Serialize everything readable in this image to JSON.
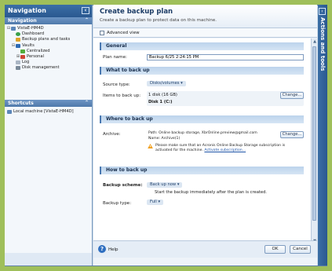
{
  "navigation": {
    "title": "Navigation",
    "section_label": "Navigation",
    "tree": [
      {
        "label": "VistaE-HM4D",
        "icon": "computer-icon",
        "indent": 0,
        "expander": "⊟"
      },
      {
        "label": "Dashboard",
        "icon": "dashboard-icon",
        "indent": 1,
        "expander": ""
      },
      {
        "label": "Backup plans and tasks",
        "icon": "backup-plans-icon",
        "indent": 1,
        "expander": ""
      },
      {
        "label": "Vaults",
        "icon": "vault-icon",
        "indent": 1,
        "expander": "⊟"
      },
      {
        "label": "Centralized",
        "icon": "centralized-vault-icon",
        "indent": 2,
        "expander": ""
      },
      {
        "label": "Personal",
        "icon": "personal-vault-icon",
        "indent": 2,
        "expander": "⊞"
      },
      {
        "label": "Log",
        "icon": "log-icon",
        "indent": 1,
        "expander": ""
      },
      {
        "label": "Disk management",
        "icon": "disk-management-icon",
        "indent": 1,
        "expander": ""
      }
    ],
    "shortcuts_label": "Shortcuts",
    "shortcut_item": "Local machine [VistaE-HM4D]"
  },
  "dialog": {
    "title": "Create backup plan",
    "subtitle": "Create a backup plan to protect data on this machine.",
    "advanced_view_label": "Advanced view",
    "sections": {
      "general": "General",
      "what": "What to back up",
      "where": "Where to back up",
      "how": "How to back up"
    },
    "plan_name_label": "Plan name:",
    "plan_name_value": "Backup 6/25 2:24:15 PM",
    "source_type_label": "Source type:",
    "source_type_value": "Disks/volumes",
    "items_label": "Items to back up:",
    "items_line1": "1 disk (16 GB)",
    "items_line2": "Disk 1 (C:)",
    "change_label": "Change...",
    "archive_label": "Archive:",
    "archive_line1": "Path: Online backup storage, XbrOnline.preview@gmail.com",
    "archive_line2": "Name: Archive(1)",
    "archive_change_label": "Change...",
    "warning_text": "Please make sure that an Acronis Online Backup Storage subscription is activated for the machine.",
    "activate_link": "Activate subscription...",
    "scheme_label": "Backup scheme:",
    "scheme_value": "Back up now",
    "scheme_desc": "Start the backup immediately after the plan is created.",
    "type_label": "Backup type:",
    "type_value": "Full"
  },
  "footer": {
    "help_label": "Help",
    "ok_label": "OK",
    "cancel_label": "Cancel"
  },
  "right_panel": {
    "title": "Actions and tools"
  },
  "colors": {
    "background": "#9fbf5a",
    "title_bar": "#2a5890",
    "section_band": "#bcd3ec",
    "link": "#1f55a8"
  }
}
